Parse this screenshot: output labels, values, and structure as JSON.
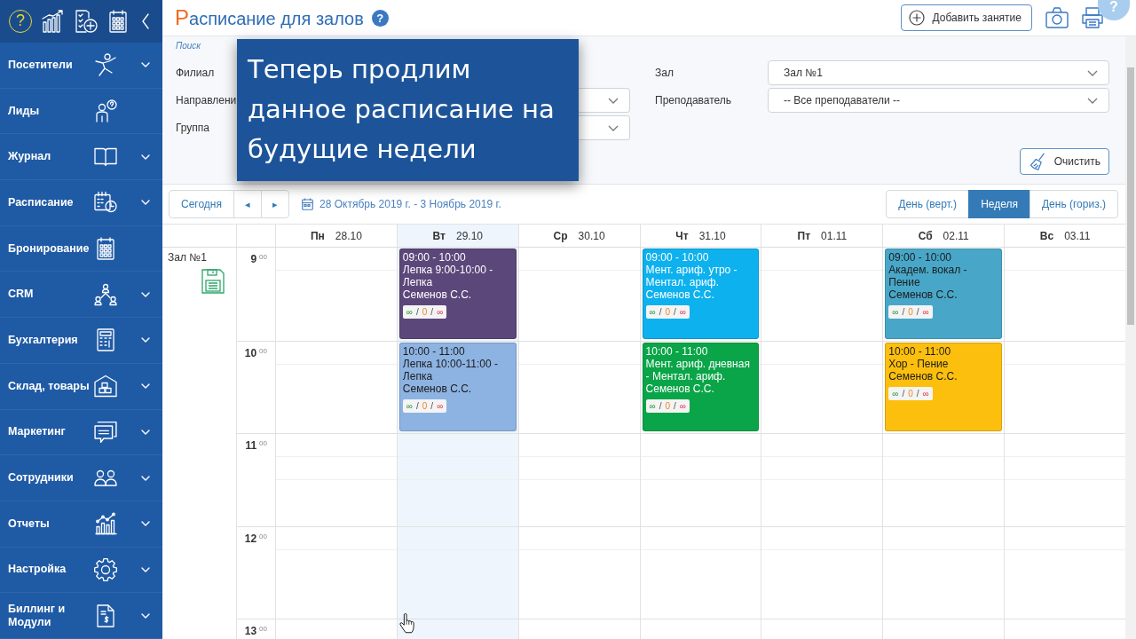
{
  "sidebar": {
    "help": "?",
    "items": [
      {
        "label": "Посетители",
        "has_submenu": true
      },
      {
        "label": "Лиды",
        "has_submenu": false
      },
      {
        "label": "Журнал",
        "has_submenu": true
      },
      {
        "label": "Расписание",
        "has_submenu": true
      },
      {
        "label": "Бронирование",
        "has_submenu": false
      },
      {
        "label": "CRM",
        "has_submenu": true
      },
      {
        "label": "Бухгалтерия",
        "has_submenu": true
      },
      {
        "label": "Склад, товары",
        "has_submenu": true
      },
      {
        "label": "Маркетинг",
        "has_submenu": true
      },
      {
        "label": "Сотрудники",
        "has_submenu": true
      },
      {
        "label": "Отчеты",
        "has_submenu": true
      },
      {
        "label": "Настройка",
        "has_submenu": true
      },
      {
        "label": "Биллинг и Модули",
        "has_submenu": true
      }
    ]
  },
  "header": {
    "title": "Расписание для залов",
    "help": "?",
    "add_button": "Добавить занятие",
    "corner_help": "?"
  },
  "filters": {
    "caption": "Поиск",
    "left": [
      {
        "label": "Филиал",
        "has_select": false
      },
      {
        "label": "Направлени",
        "has_select": true
      },
      {
        "label": "Группа",
        "has_select": true
      }
    ],
    "right": [
      {
        "label": "Зал",
        "value": "Зал №1"
      },
      {
        "label": "Преподаватель",
        "value": "-- Все преподаватели --"
      }
    ],
    "clear_button": "Очистить"
  },
  "callout": {
    "lines": [
      "Теперь продлим",
      "данное расписание на",
      "будущие недели"
    ]
  },
  "calendar": {
    "today_button": "Сегодня",
    "prev": "◂",
    "next": "▸",
    "range": "28 Октябрь 2019 г. - 3 Ноябрь 2019 г.",
    "views": [
      {
        "label": "День (верт.)",
        "selected": false
      },
      {
        "label": "Неделя",
        "selected": true
      },
      {
        "label": "День (гориз.)",
        "selected": false
      }
    ],
    "days": [
      {
        "name": "Пн",
        "date": "28.10",
        "today": false
      },
      {
        "name": "Вт",
        "date": "29.10",
        "today": true
      },
      {
        "name": "Ср",
        "date": "30.10",
        "today": false
      },
      {
        "name": "Чт",
        "date": "31.10",
        "today": false
      },
      {
        "name": "Пт",
        "date": "01.11",
        "today": false
      },
      {
        "name": "Сб",
        "date": "02.11",
        "today": false
      },
      {
        "name": "Вс",
        "date": "03.11",
        "today": false
      }
    ],
    "hall": "Зал №1",
    "rows": [
      {
        "time": "9$^{00}$",
        "cells": [
          {},
          {
            "event": {
              "time": "09:00 - 10:00",
              "title": "Лепка 9:00-10:00 - Лепка",
              "teacher": "Семенов С.С.",
              "color": "#5b477a",
              "dark_text": false,
              "counts": [
                {
                  "text": "∞",
                  "kind": "free"
                },
                {
                  "text": "/",
                  "kind": "separator"
                },
                {
                  "text": "0",
                  "kind": "booked"
                },
                {
                  "text": "/",
                  "kind": "separator"
                },
                {
                  "text": "∞",
                  "kind": "limit"
                }
              ]
            }
          },
          {},
          {
            "event": {
              "time": "09:00 - 10:00",
              "title": "Мент. ариф. утро - Ментал. ариф.",
              "teacher": "Семенов С.С.",
              "color": "#0db1ee",
              "dark_text": false,
              "counts": [
                {
                  "text": "∞",
                  "kind": "free"
                },
                {
                  "text": "/",
                  "kind": "separator"
                },
                {
                  "text": "0",
                  "kind": "booked"
                },
                {
                  "text": "/",
                  "kind": "separator"
                },
                {
                  "text": "∞",
                  "kind": "limit"
                }
              ]
            }
          },
          {},
          {
            "event": {
              "time": "09:00 - 10:00",
              "title": "Академ. вокал - Пение",
              "teacher": "Семенов С.С.",
              "color": "#48a7c8",
              "dark_text": true,
              "counts": [
                {
                  "text": "∞",
                  "kind": "free"
                },
                {
                  "text": "/",
                  "kind": "separator"
                },
                {
                  "text": "0",
                  "kind": "booked"
                },
                {
                  "text": "/",
                  "kind": "separator"
                },
                {
                  "text": "∞",
                  "kind": "limit"
                }
              ]
            }
          },
          {}
        ]
      },
      {
        "time": "10$^{00}$",
        "cells": [
          {},
          {
            "event": {
              "time": "10:00 - 11:00",
              "title": "Лепка 10:00-11:00 - Лепка",
              "teacher": "Семенов С.С.",
              "color": "#8db3e2",
              "dark_text": true,
              "counts": [
                {
                  "text": "∞",
                  "kind": "free"
                },
                {
                  "text": "/",
                  "kind": "separator"
                },
                {
                  "text": "0",
                  "kind": "booked"
                },
                {
                  "text": "/",
                  "kind": "separator"
                },
                {
                  "text": "∞",
                  "kind": "limit"
                }
              ]
            }
          },
          {},
          {
            "event": {
              "time": "10:00 - 11:00",
              "title": "Мент. ариф. дневная - Ментал. ариф.",
              "teacher": "Семенов С.С.",
              "color": "#0aa548",
              "dark_text": false,
              "counts": [
                {
                  "text": "∞",
                  "kind": "free"
                },
                {
                  "text": "/",
                  "kind": "separator"
                },
                {
                  "text": "0",
                  "kind": "booked"
                },
                {
                  "text": "/",
                  "kind": "separator"
                },
                {
                  "text": "∞",
                  "kind": "limit"
                }
              ]
            }
          },
          {},
          {
            "event": {
              "time": "10:00 - 11:00",
              "title": "Хор - Пение",
              "teacher": "Семенов С.С.",
              "color": "#fcbf0d",
              "dark_text": true,
              "counts": [
                {
                  "text": "∞",
                  "kind": "free"
                },
                {
                  "text": "/",
                  "kind": "separator"
                },
                {
                  "text": "0",
                  "kind": "booked"
                },
                {
                  "text": "/",
                  "kind": "separator"
                },
                {
                  "text": "∞",
                  "kind": "limit"
                }
              ]
            }
          },
          {}
        ]
      },
      {
        "time": "11$^{00}$"
      },
      {
        "time": "12$^{00}$"
      },
      {
        "time": "13$^{00}$"
      }
    ]
  }
}
